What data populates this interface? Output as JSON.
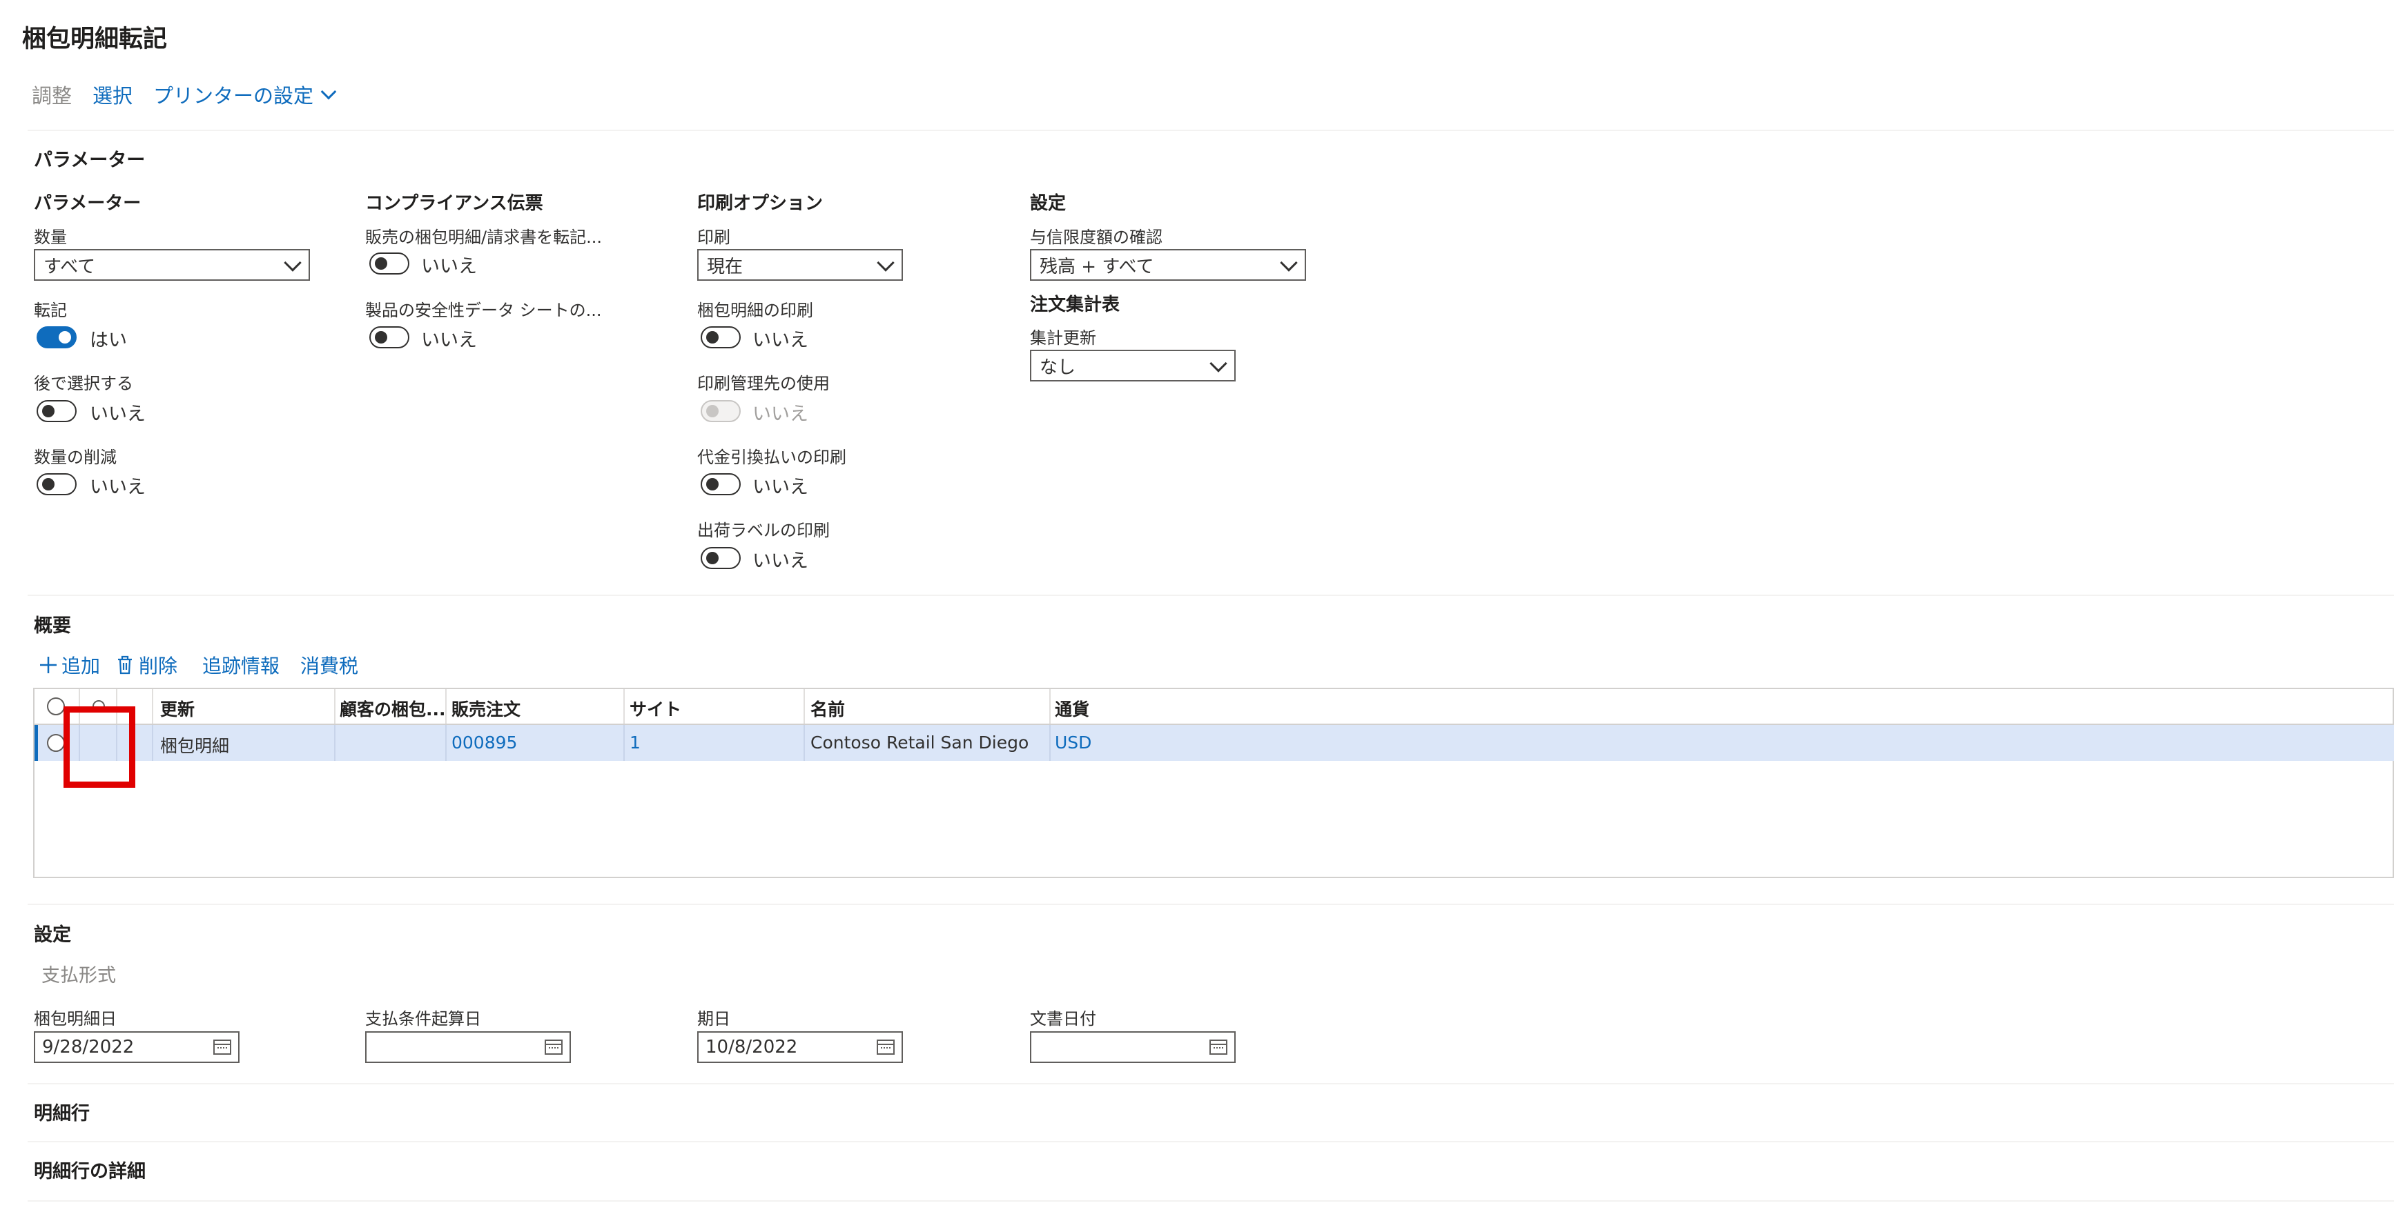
{
  "title": "梱包明細転記",
  "toolbar": {
    "adjust": "調整",
    "select": "選択",
    "printer": "プリンターの設定"
  },
  "parameters": {
    "section": "パラメーター",
    "group1": {
      "header": "パラメーター",
      "quantity_label": "数量",
      "quantity_value": "すべて",
      "post_label": "転記",
      "post_value": "はい",
      "later_label": "後で選択する",
      "later_value": "いいえ",
      "reduce_label": "数量の削減",
      "reduce_value": "いいえ"
    },
    "group2": {
      "header": "コンプライアンス伝票",
      "transfer_label": "販売の梱包明細/請求書を転記...",
      "transfer_value": "いいえ",
      "safety_label": "製品の安全性データ シートの...",
      "safety_value": "いいえ"
    },
    "group3": {
      "header": "印刷オプション",
      "print_label": "印刷",
      "print_value": "現在",
      "print_slip_label": "梱包明細の印刷",
      "print_slip_value": "いいえ",
      "printmgmt_label": "印刷管理先の使用",
      "printmgmt_value": "いいえ",
      "cod_label": "代金引換払いの印刷",
      "cod_value": "いいえ",
      "shiplabel_label": "出荷ラベルの印刷",
      "shiplabel_value": "いいえ"
    },
    "group4": {
      "header": "設定",
      "credit_label": "与信限度額の確認",
      "credit_value": "残高 + すべて",
      "summary_header": "注文集計表",
      "summary_label": "集計更新",
      "summary_value": "なし"
    }
  },
  "overview": {
    "section": "概要",
    "add": "追加",
    "delete": "削除",
    "tracking": "追跡情報",
    "tax": "消費税",
    "columns": [
      "更新",
      "顧客の梱包...",
      "販売注文",
      "サイト",
      "名前",
      "通貨"
    ],
    "row": {
      "update": "梱包明細",
      "customer_slip": "",
      "sales_order": "000895",
      "site": "1",
      "name": "Contoso Retail San Diego",
      "currency": "USD"
    }
  },
  "settings": {
    "section": "設定",
    "payment_type": "支払形式",
    "slip_date_label": "梱包明細日",
    "slip_date_value": "9/28/2022",
    "payment_start_label": "支払条件起算日",
    "payment_start_value": "",
    "period_label": "期日",
    "period_value": "10/8/2022",
    "doc_date_label": "文書日付",
    "doc_date_value": ""
  },
  "lines_section": "明細行",
  "line_details_section": "明細行の詳細",
  "colors": {
    "accent": "#0f6cbd",
    "row_selected": "#dbe6f8",
    "highlight_box": "#e00000"
  }
}
